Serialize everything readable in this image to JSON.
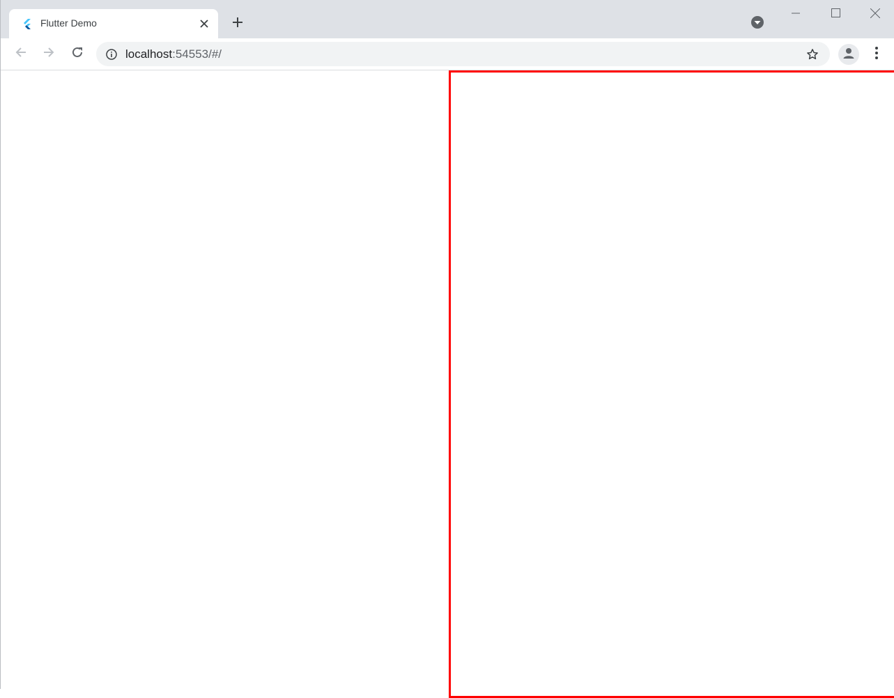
{
  "browser": {
    "tab": {
      "title": "Flutter Demo",
      "favicon": "flutter-logo-icon"
    },
    "address_bar": {
      "host": "localhost",
      "path": ":54553/#/"
    },
    "icons": {
      "close": "close-icon",
      "new_tab": "plus-icon",
      "tab_search": "chevron-down-icon",
      "minimize": "minimize-icon",
      "maximize": "maximize-icon",
      "window_close": "close-icon",
      "back": "arrow-left-icon",
      "forward": "arrow-right-icon",
      "reload": "reload-icon",
      "site_info": "info-icon",
      "bookmark": "star-icon",
      "profile": "person-icon",
      "menu": "more-vert-icon"
    }
  },
  "colors": {
    "tabstrip_bg": "#dee1e6",
    "omnibox_bg": "#f1f3f4",
    "content_border": "#ff0000"
  }
}
